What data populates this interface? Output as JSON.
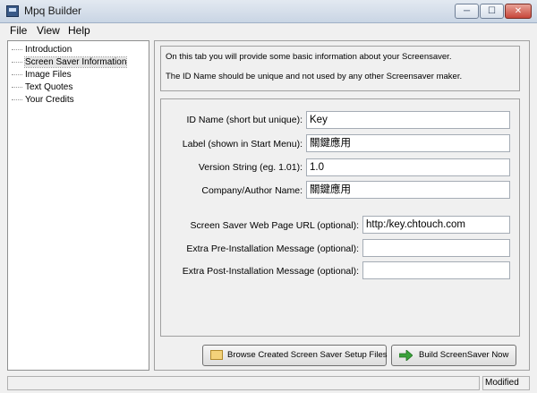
{
  "window": {
    "title": "Mpq Builder",
    "min_glyph": "─",
    "max_glyph": "☐",
    "close_glyph": "✕"
  },
  "menu": [
    "File",
    "View",
    "Help"
  ],
  "tree": {
    "items": [
      {
        "label": "Introduction",
        "selected": false
      },
      {
        "label": "Screen Saver Information",
        "selected": true
      },
      {
        "label": "Image Files",
        "selected": false
      },
      {
        "label": "Text Quotes",
        "selected": false
      },
      {
        "label": "Your Credits",
        "selected": false
      }
    ]
  },
  "info": {
    "line1": "On this tab you will provide some basic information about your Screensaver.",
    "line2": "The ID Name should be unique and not used by any other Screensaver maker."
  },
  "form": {
    "id_name": {
      "label": "ID Name (short but unique):",
      "value": "Key"
    },
    "start_label": {
      "label": "Label (shown in Start Menu):",
      "value": "關鍵應用"
    },
    "version": {
      "label": "Version String (eg. 1.01):",
      "value": "1.0"
    },
    "company": {
      "label": "Company/Author Name:",
      "value": "關鍵應用"
    },
    "web_url": {
      "label": "Screen Saver Web Page URL (optional):",
      "value": "http:/key.chtouch.com"
    },
    "pre_msg": {
      "label": "Extra Pre-Installation Message (optional):",
      "value": ""
    },
    "post_msg": {
      "label": "Extra Post-Installation Message (optional):",
      "value": ""
    }
  },
  "buttons": {
    "browse": "Browse Created Screen Saver Setup Files",
    "build": "Build ScreenSaver Now"
  },
  "status": {
    "left": "",
    "right": "Modified"
  },
  "colors": {
    "folder": "#f3d27a",
    "build_arrow": "#3aa23a"
  }
}
